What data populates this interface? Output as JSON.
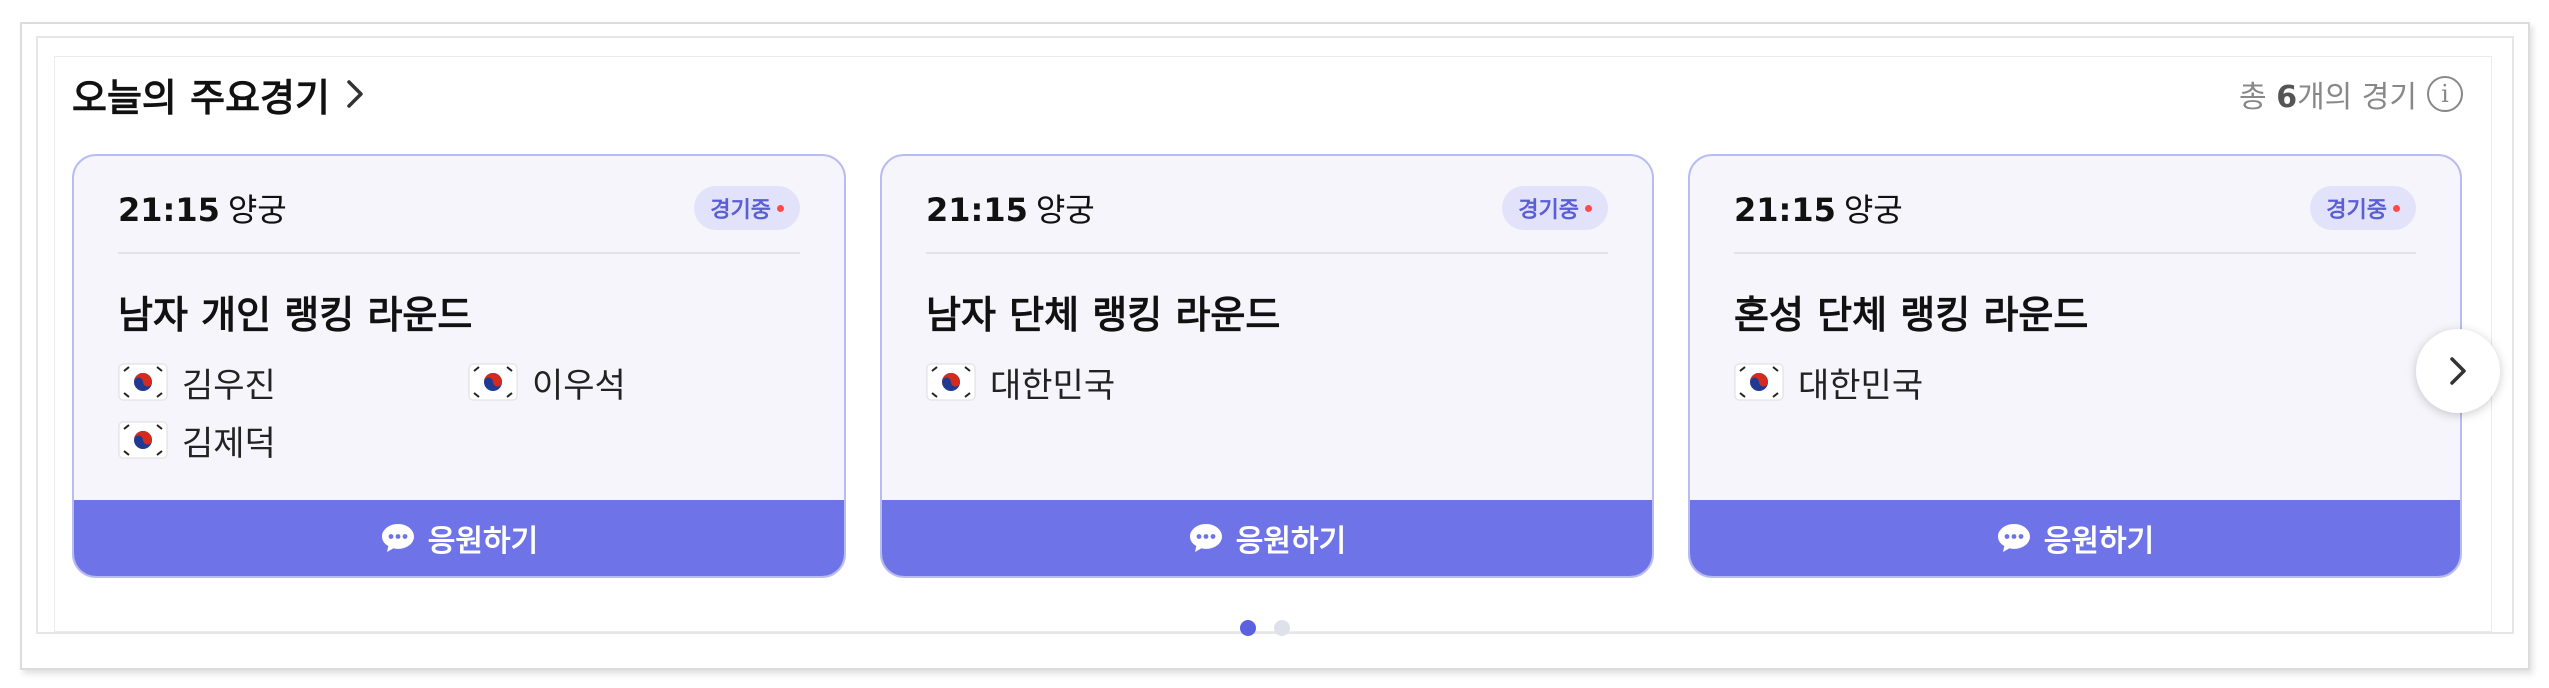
{
  "header": {
    "title": "오늘의 주요경기",
    "count_prefix": "총 ",
    "count_value": "6",
    "count_suffix": "개의 경기"
  },
  "cards": [
    {
      "time": "21:15",
      "sport": "양궁",
      "status": "경기중",
      "title": "남자 개인 랭킹 라운드",
      "athletes": [
        "김우진",
        "이우석",
        "김제덕"
      ],
      "cheer_label": "응원하기"
    },
    {
      "time": "21:15",
      "sport": "양궁",
      "status": "경기중",
      "title": "남자 단체 랭킹 라운드",
      "athletes": [
        "대한민국"
      ],
      "cheer_label": "응원하기"
    },
    {
      "time": "21:15",
      "sport": "양궁",
      "status": "경기중",
      "title": "혼성 단체 랭킹 라운드",
      "athletes": [
        "대한민국"
      ],
      "cheer_label": "응원하기"
    }
  ],
  "pager": {
    "total": 2,
    "active": 0
  },
  "colors": {
    "accent": "#6e74e8",
    "card_border": "#b8bcf0",
    "card_bg": "#f5f5fb",
    "live_dot": "#ff4a4a"
  },
  "icons": {
    "flag": "korea-flag-icon",
    "chat": "chat-bubble-icon",
    "next": "chevron-right-icon",
    "info": "info-icon"
  }
}
